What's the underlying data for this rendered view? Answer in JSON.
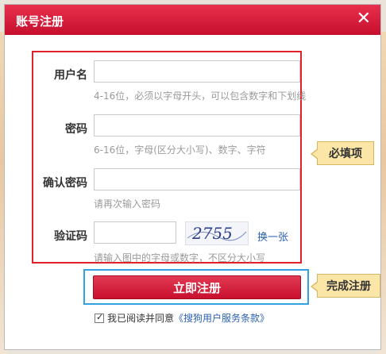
{
  "dialog": {
    "title": "账号注册",
    "close_icon": "close-icon"
  },
  "form": {
    "username_label": "用户名",
    "username_hint": "4-16位，必须以字母开头，可以包含数字和下划线",
    "password_label": "密码",
    "password_hint": "6-16位，字母(区分大小写)、数字、字符",
    "confirm_label": "确认密码",
    "confirm_hint": "请再次输入密码",
    "captcha_label": "验证码",
    "captcha_text": "2755",
    "captcha_refresh": "换一张",
    "captcha_hint": "请输入图中的字母或数字，不区分大小写"
  },
  "callouts": {
    "required": "必填项",
    "finish": "完成注册"
  },
  "actions": {
    "submit_label": "立即注册",
    "agree_checked": true,
    "agree_text": "我已阅读并同意",
    "terms_text": "《搜狗用户服务条款》"
  },
  "colors": {
    "titlebar": "#d61a38",
    "highlight_red": "#e0202a",
    "highlight_blue": "#33a1df",
    "callout_bg": "#fbe6a7",
    "link": "#2b5fb2"
  }
}
